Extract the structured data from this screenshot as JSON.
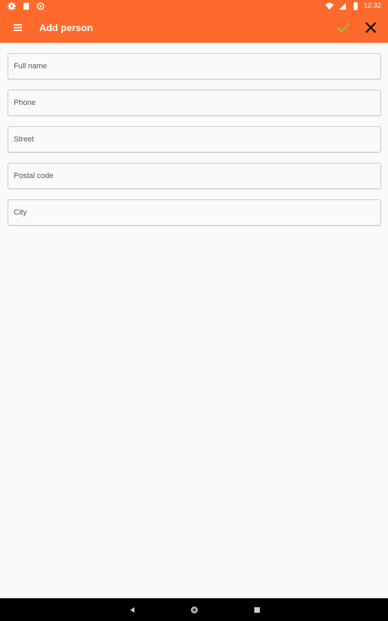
{
  "status_bar": {
    "time": "12:32",
    "left_icons": [
      "settings-icon",
      "sd-card-icon",
      "sync-icon"
    ],
    "right_icons": [
      "wifi-icon",
      "cell-signal-icon",
      "battery-icon"
    ]
  },
  "app_bar": {
    "title": "Add person",
    "background_color": "#ff6a2c",
    "menu_icon": "hamburger-menu-icon",
    "confirm_icon": "check-icon",
    "confirm_color": "#8bc34a",
    "close_icon": "close-icon"
  },
  "form": {
    "fields": [
      {
        "placeholder": "Full name",
        "value": ""
      },
      {
        "placeholder": "Phone",
        "value": ""
      },
      {
        "placeholder": "Street",
        "value": ""
      },
      {
        "placeholder": "Postal code",
        "value": ""
      },
      {
        "placeholder": "City",
        "value": ""
      }
    ]
  },
  "nav_bar": {
    "icons": [
      "back-icon",
      "home-icon",
      "recents-icon"
    ]
  }
}
